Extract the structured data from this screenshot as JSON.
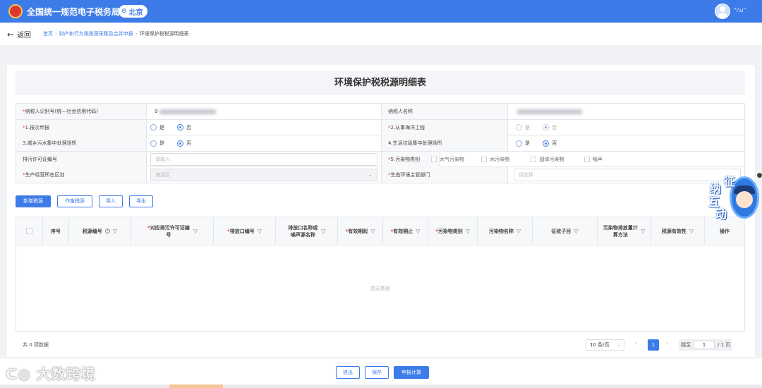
{
  "header": {
    "title": "全国统一规范电子税务局",
    "region": "北京",
    "user": "\"i\\u\""
  },
  "nav": {
    "back": "返回",
    "breadcrumbs": [
      "首页",
      "财产和行为税税源采集及合并申报",
      "环境保护税税源明细表"
    ]
  },
  "form": {
    "title": "环境保护税税源明细表",
    "taxpayer_id_label": "纳税人识别号(统一社会信用代码)",
    "taxpayer_id_value": "9",
    "taxpayer_name_label": "纳税人名称",
    "per_report_label": "1.按次申报",
    "marine_label": "2.从事海洋工程",
    "sewage_label": "3.城乡污水集中处理场所",
    "garbage_label": "4.生活垃圾集中处理场所",
    "permit_label": "排污许可证编号",
    "permit_placeholder": "请输入",
    "pollutant_label": "5.污染物类别",
    "pollutant_options": [
      "大气污染物",
      "水污染物",
      "固体污染物",
      "噪声"
    ],
    "district_label": "生产经营所在区划",
    "district_value": "海淀区",
    "authority_label": "生态环境主管部门",
    "authority_placeholder": "请选择",
    "yes": "是",
    "no": "否"
  },
  "toolbar": {
    "add": "新增税源",
    "void": "作废税源",
    "import": "导入",
    "export": "导出"
  },
  "table": {
    "columns": [
      {
        "label": "序号",
        "required": false,
        "filter": false
      },
      {
        "label": "税源编号",
        "required": false,
        "filter": true,
        "info": true
      },
      {
        "label": "对应排污许可证编号",
        "required": true,
        "filter": true
      },
      {
        "label": "排放口编号",
        "required": true,
        "filter": true
      },
      {
        "label": "排放口名称或噪声源名称",
        "required": false,
        "filter": true
      },
      {
        "label": "有效期起",
        "required": true,
        "filter": true
      },
      {
        "label": "有效期止",
        "required": true,
        "filter": true
      },
      {
        "label": "污染物类别",
        "required": true,
        "filter": true
      },
      {
        "label": "污染物名称",
        "required": false,
        "filter": true
      },
      {
        "label": "征收子目",
        "required": false,
        "filter": true
      },
      {
        "label": "污染物排放量计算方法",
        "required": false,
        "filter": true
      },
      {
        "label": "税源有效性",
        "required": false,
        "filter": true
      },
      {
        "label": "操作",
        "required": false,
        "filter": false
      }
    ],
    "empty_text": "暂无数据"
  },
  "pagination": {
    "total": "共 0 项数据",
    "page_size": "10 条/页",
    "current": "1",
    "jump_label": "跳至",
    "jump_value": "1",
    "total_pages": "/ 1 页"
  },
  "actions": {
    "exit": "退出",
    "save": "保存",
    "submit": "申报计算"
  },
  "widget": {
    "chars": [
      "征",
      "纳",
      "互",
      "动"
    ]
  },
  "watermark": "大数跨境",
  "colors": {
    "primary": "#3d7ce8",
    "required": "#e53935",
    "header_bg": "#3d7ce8"
  }
}
